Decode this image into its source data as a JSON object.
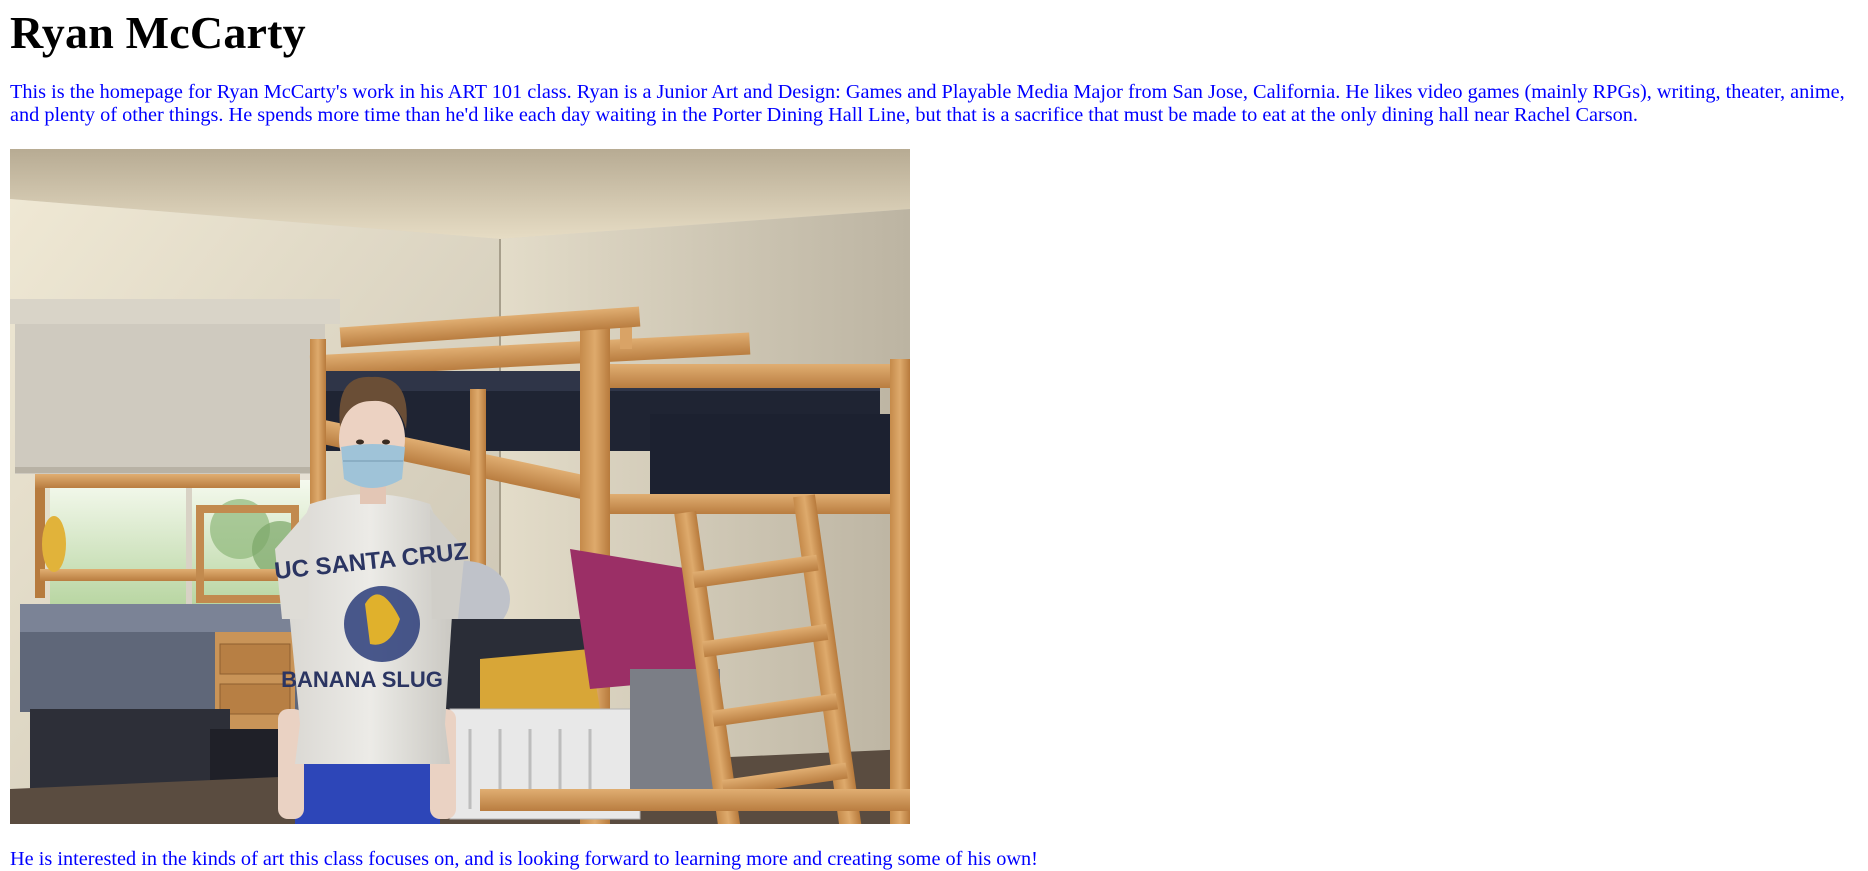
{
  "page": {
    "title": "Ryan McCarty",
    "intro": "This is the homepage for Ryan McCarty's work in his ART 101 class. Ryan is a Junior Art and Design: Games and Playable Media Major from San Jose, California. He likes video games (mainly RPGs), writing, theater, anime, and plenty of other things. He spends more time than he'd like each day waiting in the Porter Dining Hall Line, but that is a sacrifice that must be made to eat at the only dining hall near Rachel Carson.",
    "closing": "He is interested in the kinds of art this class focuses on, and is looking forward to learning more and creating some of his own!"
  },
  "photo": {
    "shirt_text_top": "UC SANTA CRUZ",
    "shirt_text_bottom": "BANANA SLUG"
  },
  "colors": {
    "text_blue": "#0000ff",
    "heading": "#000000",
    "background": "#ffffff"
  }
}
